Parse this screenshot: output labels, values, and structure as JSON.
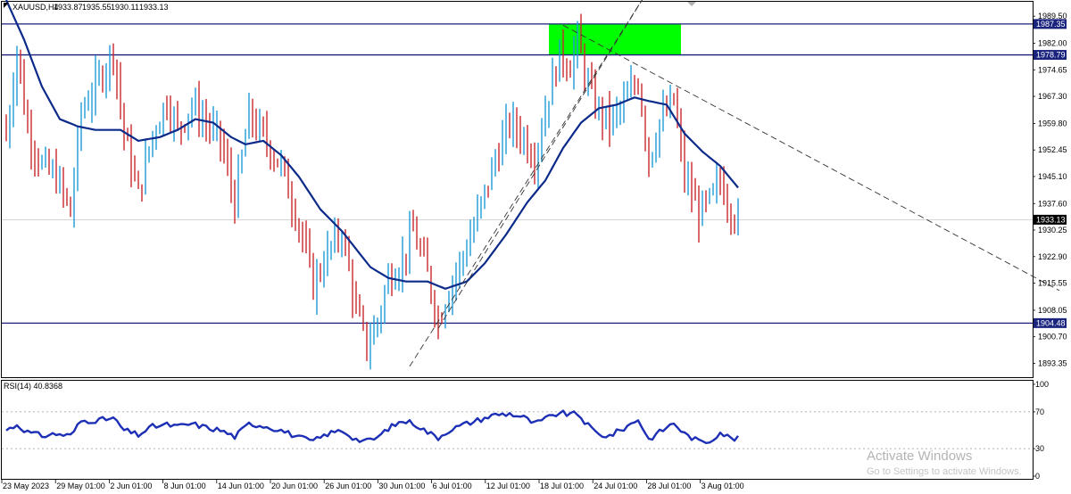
{
  "header": {
    "symbol": "XAUUSD,H4",
    "open": "1933.87",
    "high": "1935.55",
    "low": "1930.11",
    "close": "1933.13"
  },
  "rsi": {
    "label": "RSI(14) 40.8368",
    "levels": [
      100,
      70,
      30,
      0
    ]
  },
  "watermark": {
    "title": "Activate Windows",
    "subtitle": "Go to Settings to activate Windows."
  },
  "colors": {
    "bull": "#1e9bd7",
    "bear": "#c8282d",
    "ma": "#0b2a8a",
    "hline": "#1a1f7a",
    "zone": "#00ff00",
    "rsi": "#1c2fb5",
    "label_bg": "#1a237e"
  },
  "chart_data": {
    "type": "line",
    "instrument": "XAUUSD",
    "timeframe": "H4",
    "ylim": [
      1889.5,
      1993.5
    ],
    "y_ticks": [
      "1989.50",
      "1982.00",
      "1974.65",
      "1967.30",
      "1959.80",
      "1952.45",
      "1945.10",
      "1937.60",
      "1930.25",
      "1922.90",
      "1915.55",
      "1908.05",
      "1900.70",
      "1893.35"
    ],
    "x_ticks": [
      "23 May 2023",
      "29 May 01:00",
      "2 Jun 01:00",
      "8 Jun 01:00",
      "14 Jun 01:00",
      "20 Jun 01:00",
      "26 Jun 01:00",
      "30 Jun 01:00",
      "6 Jul 01:00",
      "12 Jul 01:00",
      "18 Jul 01:00",
      "24 Jul 01:00",
      "28 Jul 01:00",
      "3 Aug 01:00"
    ],
    "horizontal_levels": [
      {
        "value": 1987.35,
        "label": "1987.35"
      },
      {
        "value": 1978.79,
        "label": "1978.79"
      },
      {
        "value": 1904.48,
        "label": "1904.48"
      }
    ],
    "current_price": {
      "value": 1933.13,
      "label": "1933.13"
    },
    "supply_zone": {
      "from_x": 152,
      "to_x": 189,
      "low": 1978.79,
      "high": 1987.35
    },
    "trendlines": [
      {
        "from": [
          113,
          1892.5
        ],
        "to": [
          180,
          1997.0
        ],
        "style": "dashed"
      },
      {
        "from": [
          121,
          1903.0
        ],
        "to": [
          180,
          1997.0
        ],
        "style": "dashed"
      },
      {
        "from": [
          156,
          1987.0
        ],
        "to": [
          295,
          1913.5
        ],
        "style": "dashed"
      }
    ],
    "price_series": [
      {
        "i": 0,
        "c": 1956
      },
      {
        "i": 3,
        "c": 1980
      },
      {
        "i": 6,
        "c": 1958
      },
      {
        "i": 10,
        "c": 1948
      },
      {
        "i": 14,
        "c": 1945
      },
      {
        "i": 18,
        "c": 1935
      },
      {
        "i": 21,
        "c": 1963
      },
      {
        "i": 26,
        "c": 1972
      },
      {
        "i": 30,
        "c": 1980
      },
      {
        "i": 33,
        "c": 1957
      },
      {
        "i": 37,
        "c": 1940
      },
      {
        "i": 41,
        "c": 1957
      },
      {
        "i": 45,
        "c": 1966
      },
      {
        "i": 48,
        "c": 1958
      },
      {
        "i": 52,
        "c": 1965
      },
      {
        "i": 56,
        "c": 1960
      },
      {
        "i": 60,
        "c": 1955
      },
      {
        "i": 64,
        "c": 1938
      },
      {
        "i": 68,
        "c": 1962
      },
      {
        "i": 72,
        "c": 1956
      },
      {
        "i": 77,
        "c": 1948
      },
      {
        "i": 82,
        "c": 1932
      },
      {
        "i": 86,
        "c": 1915
      },
      {
        "i": 90,
        "c": 1924
      },
      {
        "i": 94,
        "c": 1930
      },
      {
        "i": 98,
        "c": 1908
      },
      {
        "i": 101,
        "c": 1898
      },
      {
        "i": 104,
        "c": 1905
      },
      {
        "i": 107,
        "c": 1917
      },
      {
        "i": 111,
        "c": 1922
      },
      {
        "i": 114,
        "c": 1930
      },
      {
        "i": 118,
        "c": 1918
      },
      {
        "i": 121,
        "c": 1905
      },
      {
        "i": 124,
        "c": 1914
      },
      {
        "i": 128,
        "c": 1923
      },
      {
        "i": 133,
        "c": 1937
      },
      {
        "i": 137,
        "c": 1950
      },
      {
        "i": 141,
        "c": 1960
      },
      {
        "i": 145,
        "c": 1956
      },
      {
        "i": 148,
        "c": 1950
      },
      {
        "i": 152,
        "c": 1968
      },
      {
        "i": 155,
        "c": 1979
      },
      {
        "i": 158,
        "c": 1976
      },
      {
        "i": 160,
        "c": 1983
      },
      {
        "i": 163,
        "c": 1970
      },
      {
        "i": 166,
        "c": 1963
      },
      {
        "i": 169,
        "c": 1960
      },
      {
        "i": 173,
        "c": 1965
      },
      {
        "i": 177,
        "c": 1972
      },
      {
        "i": 180,
        "c": 1950
      },
      {
        "i": 183,
        "c": 1960
      },
      {
        "i": 187,
        "c": 1966
      },
      {
        "i": 190,
        "c": 1945
      },
      {
        "i": 194,
        "c": 1935
      },
      {
        "i": 197,
        "c": 1938
      },
      {
        "i": 200,
        "c": 1944
      },
      {
        "i": 203,
        "c": 1936
      },
      {
        "i": 205,
        "c": 1933
      }
    ],
    "ma_series": [
      {
        "i": 0,
        "v": 1994
      },
      {
        "i": 5,
        "v": 1983
      },
      {
        "i": 10,
        "v": 1970
      },
      {
        "i": 15,
        "v": 1961
      },
      {
        "i": 20,
        "v": 1959
      },
      {
        "i": 25,
        "v": 1958
      },
      {
        "i": 32,
        "v": 1958
      },
      {
        "i": 37,
        "v": 1955
      },
      {
        "i": 43,
        "v": 1956
      },
      {
        "i": 48,
        "v": 1958
      },
      {
        "i": 53,
        "v": 1961
      },
      {
        "i": 58,
        "v": 1960
      },
      {
        "i": 63,
        "v": 1956
      },
      {
        "i": 67,
        "v": 1954
      },
      {
        "i": 72,
        "v": 1955
      },
      {
        "i": 77,
        "v": 1951
      },
      {
        "i": 82,
        "v": 1945
      },
      {
        "i": 88,
        "v": 1936
      },
      {
        "i": 94,
        "v": 1930
      },
      {
        "i": 98,
        "v": 1925
      },
      {
        "i": 102,
        "v": 1920
      },
      {
        "i": 107,
        "v": 1917
      },
      {
        "i": 112,
        "v": 1916
      },
      {
        "i": 118,
        "v": 1916
      },
      {
        "i": 123,
        "v": 1914
      },
      {
        "i": 129,
        "v": 1916
      },
      {
        "i": 134,
        "v": 1921
      },
      {
        "i": 140,
        "v": 1929
      },
      {
        "i": 146,
        "v": 1938
      },
      {
        "i": 151,
        "v": 1944
      },
      {
        "i": 156,
        "v": 1953
      },
      {
        "i": 161,
        "v": 1960
      },
      {
        "i": 166,
        "v": 1964
      },
      {
        "i": 171,
        "v": 1965
      },
      {
        "i": 176,
        "v": 1967
      },
      {
        "i": 180,
        "v": 1966
      },
      {
        "i": 185,
        "v": 1965
      },
      {
        "i": 190,
        "v": 1957
      },
      {
        "i": 195,
        "v": 1952
      },
      {
        "i": 200,
        "v": 1948
      },
      {
        "i": 205,
        "v": 1942
      }
    ],
    "rsi_series": [
      {
        "i": 0,
        "v": 50
      },
      {
        "i": 3,
        "v": 56
      },
      {
        "i": 6,
        "v": 48
      },
      {
        "i": 10,
        "v": 44
      },
      {
        "i": 14,
        "v": 46
      },
      {
        "i": 18,
        "v": 44
      },
      {
        "i": 21,
        "v": 60
      },
      {
        "i": 26,
        "v": 61
      },
      {
        "i": 30,
        "v": 63
      },
      {
        "i": 33,
        "v": 50
      },
      {
        "i": 37,
        "v": 45
      },
      {
        "i": 41,
        "v": 54
      },
      {
        "i": 45,
        "v": 56
      },
      {
        "i": 48,
        "v": 54
      },
      {
        "i": 52,
        "v": 57
      },
      {
        "i": 56,
        "v": 53
      },
      {
        "i": 60,
        "v": 50
      },
      {
        "i": 64,
        "v": 43
      },
      {
        "i": 68,
        "v": 57
      },
      {
        "i": 72,
        "v": 55
      },
      {
        "i": 77,
        "v": 50
      },
      {
        "i": 82,
        "v": 42
      },
      {
        "i": 86,
        "v": 38
      },
      {
        "i": 90,
        "v": 46
      },
      {
        "i": 94,
        "v": 50
      },
      {
        "i": 98,
        "v": 40
      },
      {
        "i": 101,
        "v": 38
      },
      {
        "i": 104,
        "v": 42
      },
      {
        "i": 107,
        "v": 52
      },
      {
        "i": 111,
        "v": 60
      },
      {
        "i": 114,
        "v": 58
      },
      {
        "i": 118,
        "v": 48
      },
      {
        "i": 121,
        "v": 42
      },
      {
        "i": 124,
        "v": 50
      },
      {
        "i": 128,
        "v": 56
      },
      {
        "i": 133,
        "v": 62
      },
      {
        "i": 137,
        "v": 67
      },
      {
        "i": 141,
        "v": 68
      },
      {
        "i": 145,
        "v": 64
      },
      {
        "i": 148,
        "v": 57
      },
      {
        "i": 152,
        "v": 64
      },
      {
        "i": 155,
        "v": 69
      },
      {
        "i": 158,
        "v": 67
      },
      {
        "i": 160,
        "v": 68
      },
      {
        "i": 163,
        "v": 55
      },
      {
        "i": 166,
        "v": 45
      },
      {
        "i": 169,
        "v": 44
      },
      {
        "i": 173,
        "v": 52
      },
      {
        "i": 177,
        "v": 62
      },
      {
        "i": 180,
        "v": 40
      },
      {
        "i": 183,
        "v": 48
      },
      {
        "i": 187,
        "v": 58
      },
      {
        "i": 190,
        "v": 46
      },
      {
        "i": 194,
        "v": 38
      },
      {
        "i": 197,
        "v": 38
      },
      {
        "i": 200,
        "v": 48
      },
      {
        "i": 203,
        "v": 41
      },
      {
        "i": 205,
        "v": 41
      }
    ]
  }
}
